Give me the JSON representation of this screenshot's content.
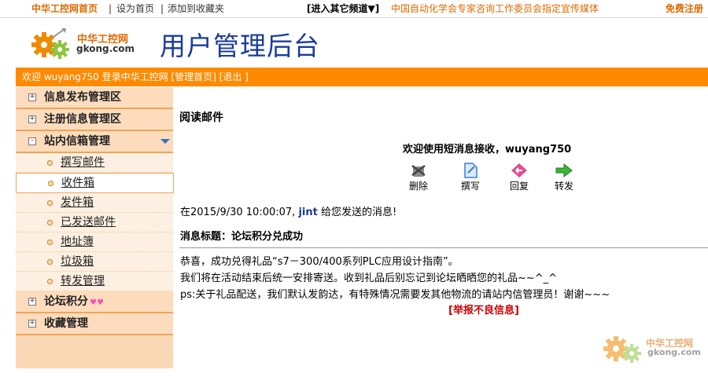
{
  "topbar": {
    "home": "中华工控网首页",
    "set_home": "设为首页",
    "add_fav": "添加到收藏夹",
    "channel": "[进入其它频道▼]",
    "media": "中国自动化学会专家咨询工作委员会指定宣传媒体",
    "register": "免费注册",
    "sep": "|"
  },
  "header": {
    "logo_cn": "中华工控网",
    "logo_en": "gkong.com",
    "title": "用户管理后台"
  },
  "welcome": {
    "text": "欢迎 wuyang750 登录中华工控网 [管理首页] [退出 ]"
  },
  "sidebar": {
    "sections": [
      {
        "label": "信息发布管理区",
        "toggle": "+"
      },
      {
        "label": "注册信息管理区",
        "toggle": "+"
      },
      {
        "label": "站内信箱管理",
        "toggle": "-"
      }
    ],
    "mailbox_items": [
      {
        "label": "撰写邮件"
      },
      {
        "label": "收件箱"
      },
      {
        "label": "发件箱"
      },
      {
        "label": "已发送邮件"
      },
      {
        "label": "地址簿"
      },
      {
        "label": "垃圾箱"
      },
      {
        "label": "转发管理"
      }
    ],
    "forum": {
      "label": "论坛积分",
      "toggle": "+",
      "badge": "♥♥"
    },
    "favorites": {
      "label": "收藏管理",
      "toggle": "+"
    }
  },
  "main": {
    "title": "阅读邮件",
    "greeting": "欢迎使用短消息接收，wuyang750",
    "actions": [
      {
        "label": "删除",
        "icon": "delete-icon",
        "color": "#6a6a6a"
      },
      {
        "label": "撰写",
        "icon": "compose-icon",
        "color": "#3a7fd0"
      },
      {
        "label": "回复",
        "icon": "reply-icon",
        "color": "#d0357a"
      },
      {
        "label": "转发",
        "icon": "forward-icon",
        "color": "#2aa02a"
      }
    ],
    "msg_prefix": "在2015/9/30 10:00:07, ",
    "msg_user": "jint",
    "msg_suffix": " 给您发送的消息!",
    "subject": "消息标题：论坛积分兑成功",
    "body": [
      "恭喜，成功兑得礼品“s7－300/400系列PLC应用设计指南”。",
      "我们将在活动结束后统一安排寄送。收到礼品后别忘记到论坛晒晒您的礼品~~^_^",
      "ps:关于礼品配送，我们默认发韵达，有特殊情况需要发其他物流的请站内信管理员！谢谢~~~"
    ],
    "report": "[举报不良信息]"
  },
  "colors": {
    "accent": "#ff8a00",
    "brand": "#1a3c9a",
    "report": "#cc0000"
  }
}
